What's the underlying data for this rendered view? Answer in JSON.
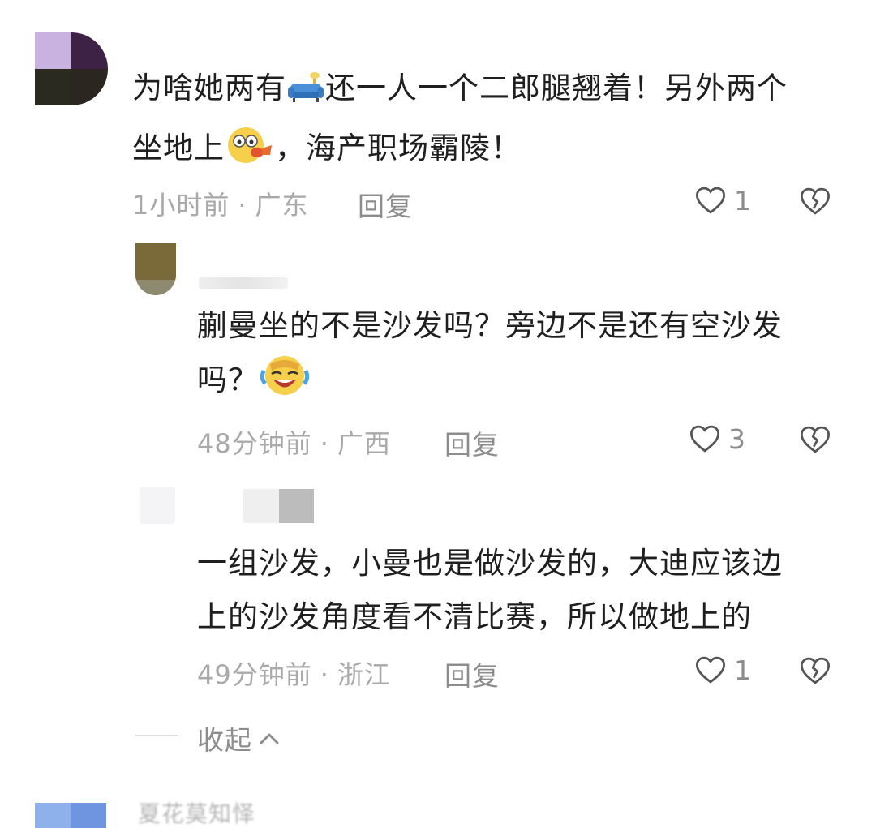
{
  "comments": [
    {
      "text_line1_a": "为啥她两有",
      "text_line1_b": "还一人一个二郎腿翘着！另外两个",
      "text_line2_a": "坐地上",
      "text_line2_b": "，海产职场霸陵！",
      "emoji_1": "sofa-emoji",
      "emoji_2": "vomit-face-emoji",
      "time": "1小时前",
      "location": "广东",
      "reply_label": "回复",
      "likes": "1"
    },
    {
      "text_line1": "蒯曼坐的不是沙发吗？旁边不是还有空沙发",
      "text_line2_a": "吗？",
      "emoji_1": "laughing-crying-face-emoji",
      "time": "48分钟前",
      "location": "广西",
      "reply_label": "回复",
      "likes": "3"
    },
    {
      "text_line1": "一组沙发，小曼也是做沙发的，大迪应该边",
      "text_line2": "上的沙发角度看不清比赛，所以做地上的",
      "time": "49分钟前",
      "location": "浙江",
      "reply_label": "回复",
      "likes": "1"
    }
  ],
  "separator": "·",
  "collapse_label": "收起",
  "bottom_username": "夏花莫知怿",
  "icons": {
    "like": "heart-outline-icon",
    "dislike": "broken-heart-icon",
    "collapse": "chevron-up-icon"
  },
  "colors": {
    "text": "#1f1f1f",
    "meta": "#a9a9a9",
    "action": "#8d8d8d"
  }
}
